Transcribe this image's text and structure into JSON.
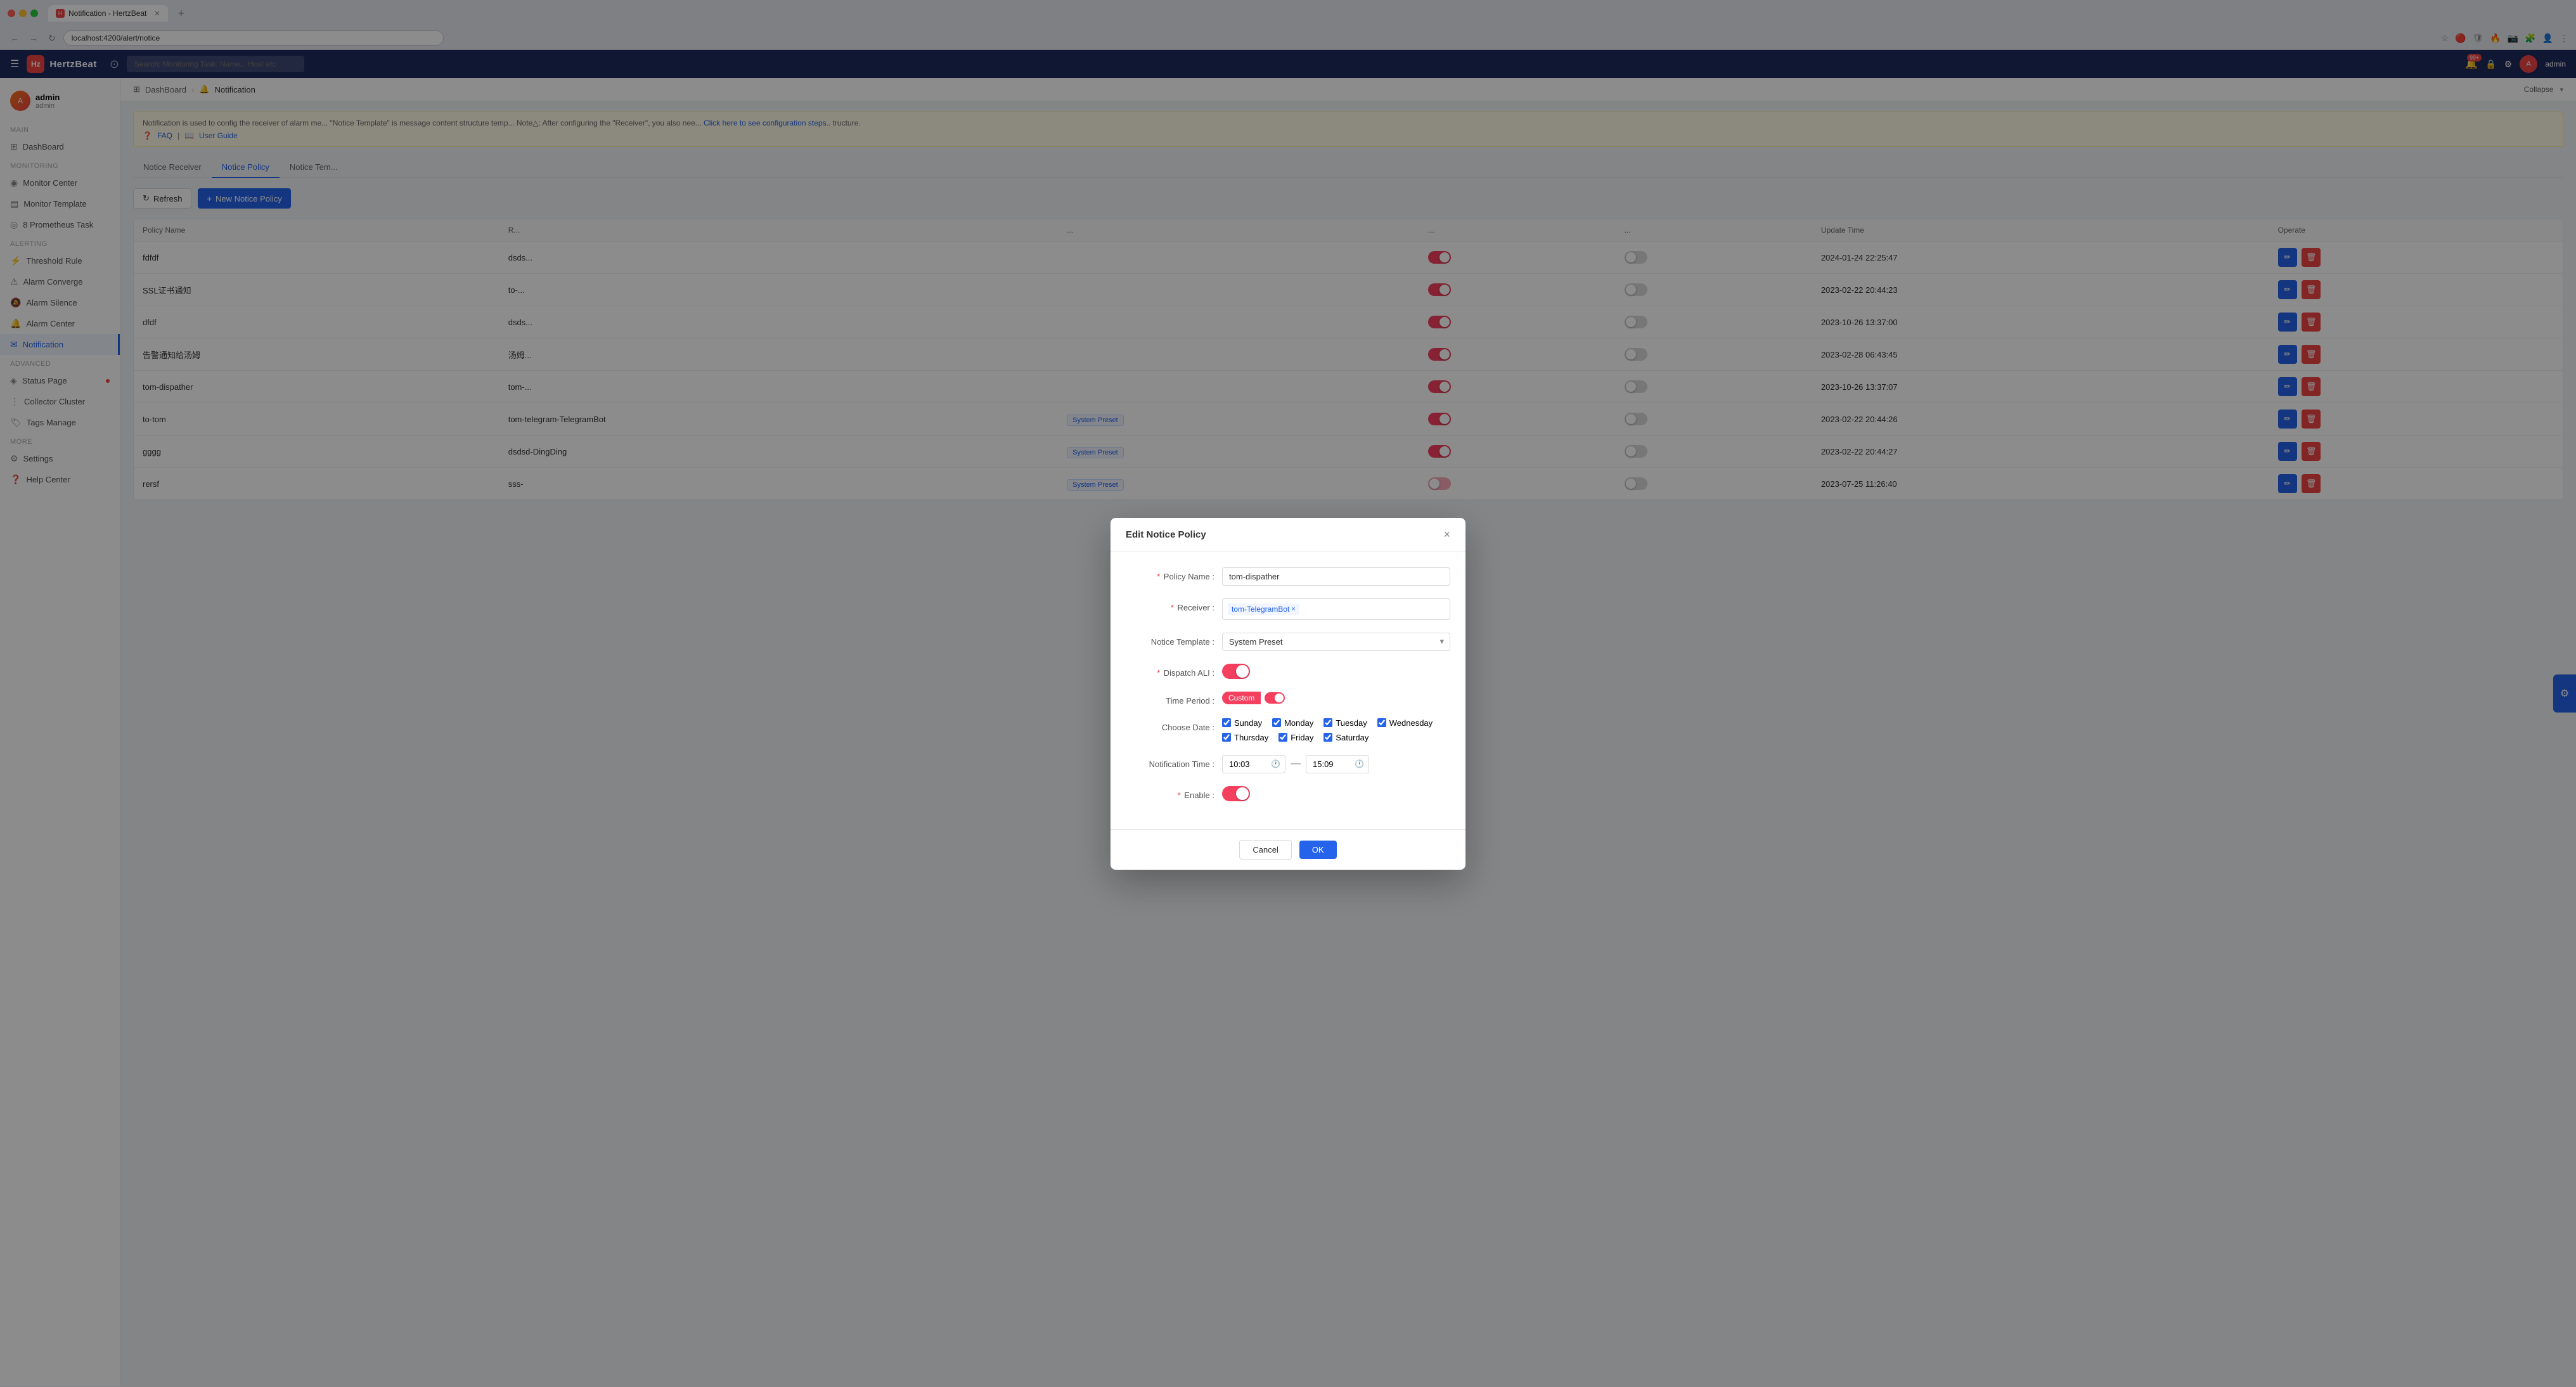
{
  "browser": {
    "url": "localhost:4200/alert/notice",
    "tab_title": "Notification - HertzBeat",
    "tab_icon": "H"
  },
  "app": {
    "name": "HertzBeat",
    "search_placeholder": "Search: Monitoring Task: Name、Host etc",
    "header_icons": [
      "menu-icon",
      "github-icon"
    ],
    "notification_badge": "99+",
    "admin_label": "admin"
  },
  "sidebar": {
    "user_name": "admin",
    "user_role": "admin",
    "sections": [
      {
        "label": "Main",
        "items": [
          {
            "id": "dashboard",
            "label": "DashBoard",
            "icon": "⊞",
            "active": false
          }
        ]
      },
      {
        "label": "Monitoring",
        "items": [
          {
            "id": "monitor-center",
            "label": "Monitor Center",
            "icon": "◉",
            "active": false
          },
          {
            "id": "monitor-template",
            "label": "Monitor Template",
            "icon": "▤",
            "active": false
          },
          {
            "id": "prometheus-task",
            "label": "8 Prometheus Task",
            "icon": "◎",
            "active": false
          }
        ]
      },
      {
        "label": "Alerting",
        "items": [
          {
            "id": "threshold-rule",
            "label": "Threshold Rule",
            "icon": "⚡",
            "active": false
          },
          {
            "id": "alarm-converge",
            "label": "Alarm Converge",
            "icon": "⚠",
            "active": false
          },
          {
            "id": "alarm-silence",
            "label": "Alarm Silence",
            "icon": "🔕",
            "active": false
          },
          {
            "id": "alarm-center",
            "label": "Alarm Center",
            "icon": "🔔",
            "active": false
          },
          {
            "id": "notification",
            "label": "Notification",
            "icon": "✉",
            "active": true
          }
        ]
      },
      {
        "label": "Advanced",
        "items": [
          {
            "id": "status-page",
            "label": "Status Page",
            "icon": "◈",
            "active": false,
            "dot": true
          },
          {
            "id": "collector-cluster",
            "label": "Collector Cluster",
            "icon": "⋮",
            "active": false
          },
          {
            "id": "tags-manage",
            "label": "Tags Manage",
            "icon": "🏷",
            "active": false
          }
        ]
      },
      {
        "label": "More",
        "items": [
          {
            "id": "settings",
            "label": "Settings",
            "icon": "⚙",
            "active": false
          },
          {
            "id": "help-center",
            "label": "Help Center",
            "icon": "❓",
            "active": false
          }
        ]
      }
    ]
  },
  "breadcrumb": {
    "items": [
      "DashBoard",
      "Notification"
    ],
    "collapse_label": "Collapse"
  },
  "notification_page": {
    "description": "Notification is used to config the receiver of alarm me... \"Notice Template\" is message content structure temp... Note△: After configuring the \"Receiver\", you also nee...",
    "description_link": "Click here to see configuration steps..",
    "faq_label": "FAQ",
    "user_guide_label": "User Guide"
  },
  "tabs": [
    {
      "id": "notice-receiver",
      "label": "Notice Receiver",
      "active": false
    },
    {
      "id": "notice-policy",
      "label": "Notice Policy",
      "active": true
    },
    {
      "id": "notice-template",
      "label": "Notice Tem...",
      "active": false
    }
  ],
  "toolbar": {
    "refresh_label": "Refresh",
    "new_policy_label": "New Notice Policy"
  },
  "table": {
    "columns": [
      "Policy Name",
      "R...",
      "...",
      "...",
      "Update Time",
      "Operate"
    ],
    "rows": [
      {
        "id": 1,
        "name": "fdfdf",
        "receiver": "dsds...",
        "template": "",
        "dispatch": true,
        "time_period": false,
        "update_time": "2024-01-24 22:25:47"
      },
      {
        "id": 2,
        "name": "SSL证书通知",
        "receiver": "to-...",
        "template": "",
        "dispatch": true,
        "time_period": false,
        "update_time": "2023-02-22 20:44:23"
      },
      {
        "id": 3,
        "name": "dfdf",
        "receiver": "dsds...",
        "template": "",
        "dispatch": true,
        "time_period": false,
        "update_time": "2023-10-26 13:37:00"
      },
      {
        "id": 4,
        "name": "告警通知给汤姆",
        "receiver": "汤姆...",
        "template": "",
        "dispatch": true,
        "time_period": false,
        "update_time": "2023-02-28 06:43:45"
      },
      {
        "id": 5,
        "name": "tom-dispather",
        "receiver": "tom-...",
        "template": "",
        "dispatch": true,
        "time_period": false,
        "update_time": "2023-10-26 13:37:07"
      },
      {
        "id": 6,
        "name": "to-tom",
        "receiver": "tom-telegram-TelegramBot",
        "template": "System Preset",
        "dispatch": true,
        "time_period": false,
        "update_time": "2023-02-22 20:44:26"
      },
      {
        "id": 7,
        "name": "gggg",
        "receiver": "dsdsd-DingDing",
        "template": "System Preset",
        "dispatch": true,
        "time_period": false,
        "update_time": "2023-02-22 20:44:27"
      },
      {
        "id": 8,
        "name": "rersf",
        "receiver": "sss-",
        "template": "System Preset",
        "dispatch": true,
        "time_period": false,
        "update_time": "2023-07-25 11:26:40"
      }
    ]
  },
  "modal": {
    "title": "Edit Notice Policy",
    "close_icon": "×",
    "fields": {
      "policy_name_label": "Policy Name :",
      "policy_name_value": "tom-dispather",
      "receiver_label": "Receiver :",
      "receiver_tag": "tom-TelegramBot",
      "notice_template_label": "Notice Template :",
      "notice_template_value": "System Preset",
      "dispatch_ali_label": "Dispatch ALI :",
      "time_period_label": "Time Period :",
      "time_period_value": "Custom",
      "choose_date_label": "Choose Date :",
      "days": [
        {
          "label": "Sunday",
          "checked": true
        },
        {
          "label": "Monday",
          "checked": true
        },
        {
          "label": "Tuesday",
          "checked": true
        },
        {
          "label": "Wednesday",
          "checked": true
        },
        {
          "label": "Thursday",
          "checked": true
        },
        {
          "label": "Friday",
          "checked": true
        },
        {
          "label": "Saturday",
          "checked": true
        }
      ],
      "notification_time_label": "Notification Time :",
      "time_start": "10:03",
      "time_end": "15:09",
      "enable_label": "Enable :"
    },
    "cancel_label": "Cancel",
    "ok_label": "OK"
  }
}
